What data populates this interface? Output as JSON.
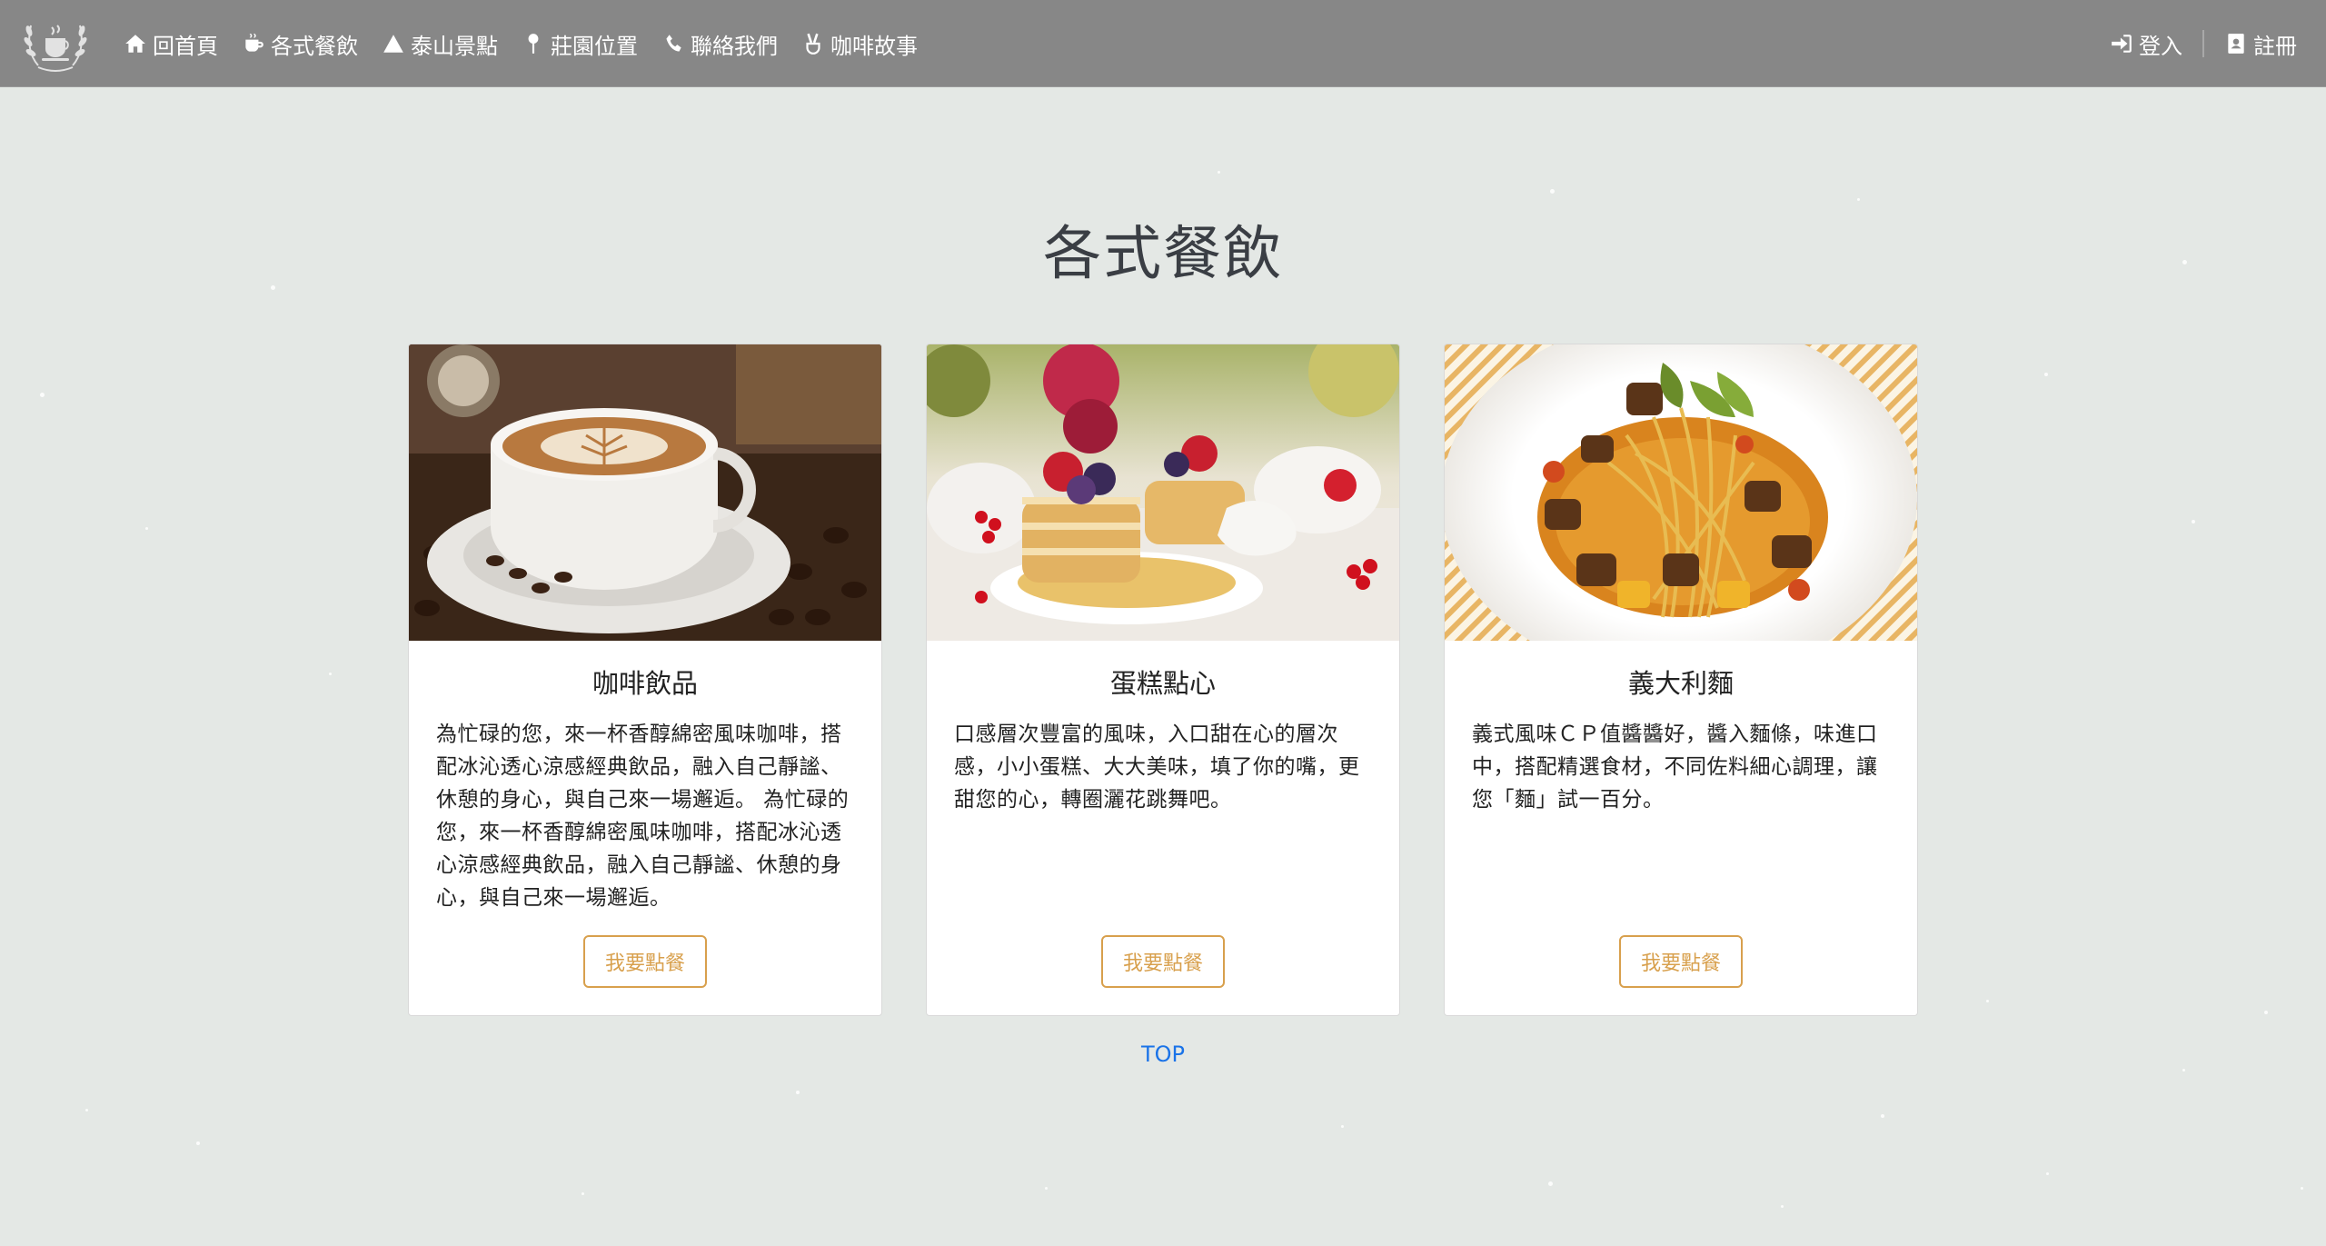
{
  "nav": {
    "home": "回首頁",
    "menu": "各式餐飲",
    "scenic": "泰山景點",
    "location": "莊園位置",
    "contact": "聯絡我們",
    "story": "咖啡故事",
    "login": "登入",
    "register": "註冊"
  },
  "page": {
    "title": "各式餐飲"
  },
  "cards": [
    {
      "title": "咖啡飲品",
      "text": "為忙碌的您，來一杯香醇綿密風味咖啡，搭配冰沁透心涼感經典飲品，融入自己靜謐、休憩的身心，與自己來一場邂逅。 為忙碌的您，來一杯香醇綿密風味咖啡，搭配冰沁透心涼感經典飲品，融入自己靜謐、休憩的身心，與自己來一場邂逅。",
      "button": "我要點餐"
    },
    {
      "title": "蛋糕點心",
      "text": "口感層次豐富的風味，入口甜在心的層次感，小小蛋糕、大大美味，填了你的嘴，更甜您的心，轉圈灑花跳舞吧。",
      "button": "我要點餐"
    },
    {
      "title": "義大利麵",
      "text": "義式風味ＣＰ值醬醬好，醬入麵條，味進口中，搭配精選食材，不同佐料細心調理，讓您「麵」試一百分。",
      "button": "我要點餐"
    }
  ],
  "footer": {
    "top": "TOP"
  },
  "colors": {
    "navbar": "#878787",
    "background": "#e4e8e5",
    "accent": "#d8a04d",
    "link": "#1a73e8"
  },
  "icons": {
    "brand": "laurel-coffee-logo",
    "home": "home-icon",
    "menu": "coffee-cup-icon",
    "scenic": "mountain-icon",
    "location": "map-pin-icon",
    "contact": "phone-icon",
    "story": "peace-hand-icon",
    "login": "sign-in-icon",
    "register": "id-badge-icon"
  }
}
